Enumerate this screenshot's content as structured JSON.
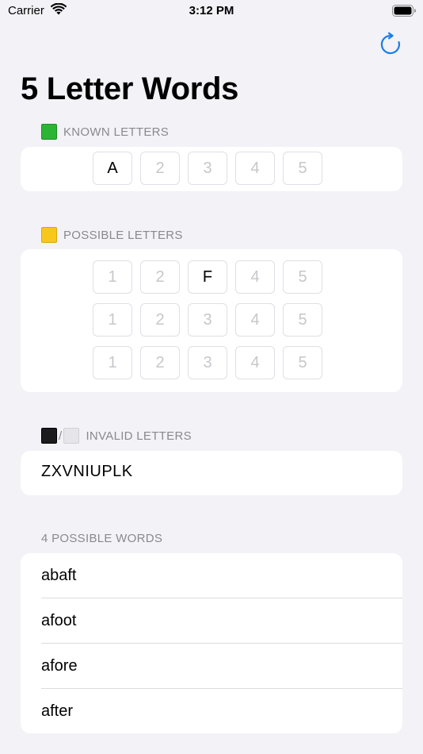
{
  "status_bar": {
    "carrier": "Carrier",
    "time": "3:12 PM"
  },
  "nav": {
    "refresh_icon": "refresh-icon"
  },
  "title": "5 Letter Words",
  "known": {
    "header": "KNOWN LETTERS",
    "boxes": [
      {
        "text": "A",
        "filled": true
      },
      {
        "text": "2",
        "filled": false
      },
      {
        "text": "3",
        "filled": false
      },
      {
        "text": "4",
        "filled": false
      },
      {
        "text": "5",
        "filled": false
      }
    ]
  },
  "possible": {
    "header": "POSSIBLE LETTERS",
    "rows": [
      [
        {
          "text": "1",
          "filled": false
        },
        {
          "text": "2",
          "filled": false
        },
        {
          "text": "F",
          "filled": true
        },
        {
          "text": "4",
          "filled": false
        },
        {
          "text": "5",
          "filled": false
        }
      ],
      [
        {
          "text": "1",
          "filled": false
        },
        {
          "text": "2",
          "filled": false
        },
        {
          "text": "3",
          "filled": false
        },
        {
          "text": "4",
          "filled": false
        },
        {
          "text": "5",
          "filled": false
        }
      ],
      [
        {
          "text": "1",
          "filled": false
        },
        {
          "text": "2",
          "filled": false
        },
        {
          "text": "3",
          "filled": false
        },
        {
          "text": "4",
          "filled": false
        },
        {
          "text": "5",
          "filled": false
        }
      ]
    ]
  },
  "invalid": {
    "header": "INVALID LETTERS",
    "separator": "/",
    "value": "ZXVNIUPLK"
  },
  "words": {
    "header": "4 POSSIBLE WORDS",
    "items": [
      "abaft",
      "afoot",
      "afore",
      "after"
    ]
  },
  "colors": {
    "accent": "#1a7ee6",
    "background": "#f2f2f7",
    "green": "#2bb534",
    "yellow": "#f8c71b"
  }
}
